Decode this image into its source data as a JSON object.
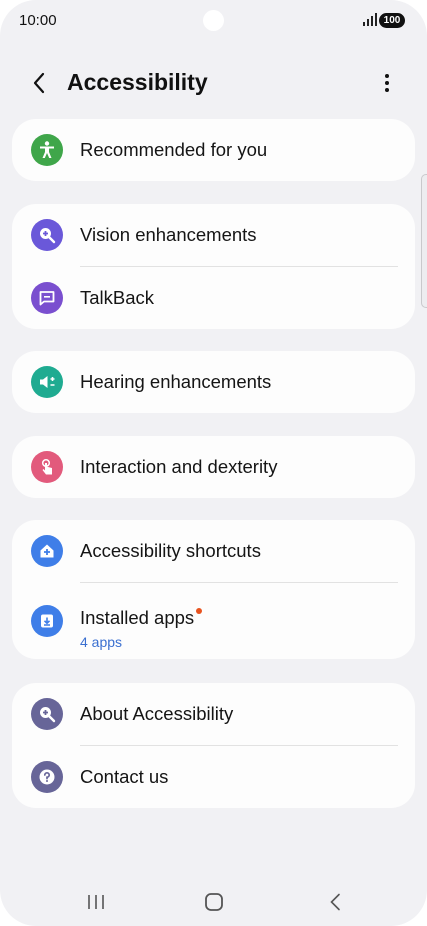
{
  "status": {
    "time": "10:00",
    "battery": "100"
  },
  "header": {
    "title": "Accessibility"
  },
  "groups": [
    {
      "items": [
        {
          "label": "Recommended for you",
          "icon": "accessibility-person-icon",
          "color": "#3fa64a"
        }
      ]
    },
    {
      "items": [
        {
          "label": "Vision enhancements",
          "icon": "zoom-in-icon",
          "color": "#6a58d9"
        },
        {
          "label": "TalkBack",
          "icon": "chat-bubble-icon",
          "color": "#7a4fcf"
        }
      ]
    },
    {
      "items": [
        {
          "label": "Hearing enhancements",
          "icon": "volume-icon",
          "color": "#1fab91"
        }
      ]
    },
    {
      "items": [
        {
          "label": "Interaction and dexterity",
          "icon": "touch-hand-icon",
          "color": "#e25a7c"
        }
      ]
    },
    {
      "items": [
        {
          "label": "Accessibility shortcuts",
          "icon": "home-plus-icon",
          "color": "#3f7ee8"
        },
        {
          "label": "Installed apps",
          "sublabel": "4 apps",
          "icon": "download-icon",
          "color": "#3f7ee8"
        }
      ]
    },
    {
      "items": [
        {
          "label": "About Accessibility",
          "icon": "info-search-icon",
          "color": "#676598"
        },
        {
          "label": "Contact us",
          "icon": "question-icon",
          "color": "#676598"
        }
      ]
    }
  ],
  "colors": {
    "background": "#f1f1f4",
    "card": "#fdfdfd",
    "link": "#3a6fd0",
    "badge": "#e8531f"
  }
}
